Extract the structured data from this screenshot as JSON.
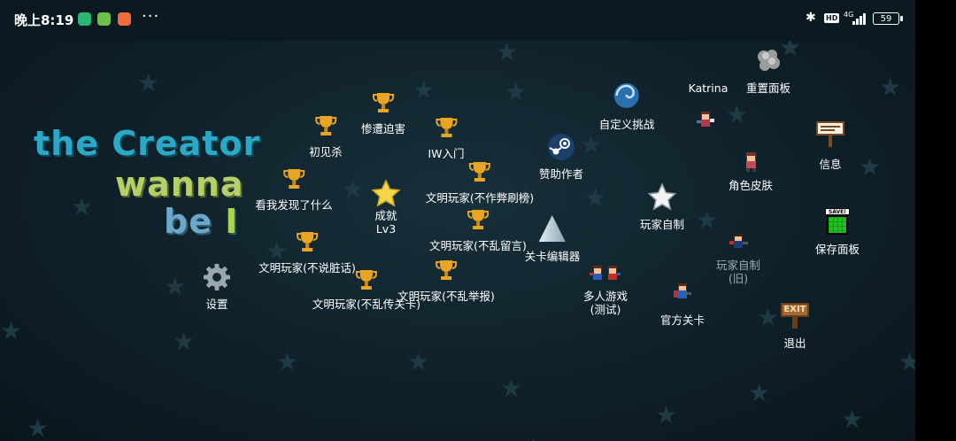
{
  "status_bar": {
    "time": "晚上8:19",
    "left_apps": [
      "green-app-icon",
      "green-download-icon",
      "orange-app-icon"
    ],
    "more": "···",
    "network": "4G",
    "hd": "HD",
    "battery": "59"
  },
  "title": {
    "line1": "the Creator",
    "line2": "wanna",
    "line3_a": "be ",
    "line3_b": "I"
  },
  "menu": {
    "settings": "设置",
    "first_kill": "初见杀",
    "suffered_persecution": "惨遭迫害",
    "iw_intro": "IW入门",
    "what_i_found": "看我发现了什么",
    "achievement_label": "成就",
    "achievement_level": "Lv3",
    "civil_no_cheat": "文明玩家(不作弊刷榜)",
    "civil_no_spam_comment": "文明玩家(不乱留言)",
    "civil_no_swearing": "文明玩家(不说脏话)",
    "civil_no_spam_levels": "文明玩家(不乱传关卡)",
    "civil_no_false_report": "文明玩家(不乱举报)",
    "sponsor_author": "赞助作者",
    "level_editor": "关卡编辑器",
    "custom_challenge": "自定义挑战",
    "player_made": "玩家自制",
    "multiplayer": "多人游戏",
    "multiplayer_test": "(测试)",
    "katrina": "Katrina",
    "reset_panel": "重置面板",
    "character_skin": "角色皮肤",
    "player_made_old": "玩家自制",
    "player_made_old_tag": "(旧)",
    "official_levels": "官方关卡",
    "info": "信息",
    "save_panel": "保存面板",
    "exit": "退出",
    "save_sign": "SAVE!",
    "exit_sign": "EXIT"
  },
  "colors": {
    "background": "#0f2029",
    "trophy": "#e8a524",
    "title_blue": "#2aa8c6",
    "title_green": "#b5cf6a"
  }
}
